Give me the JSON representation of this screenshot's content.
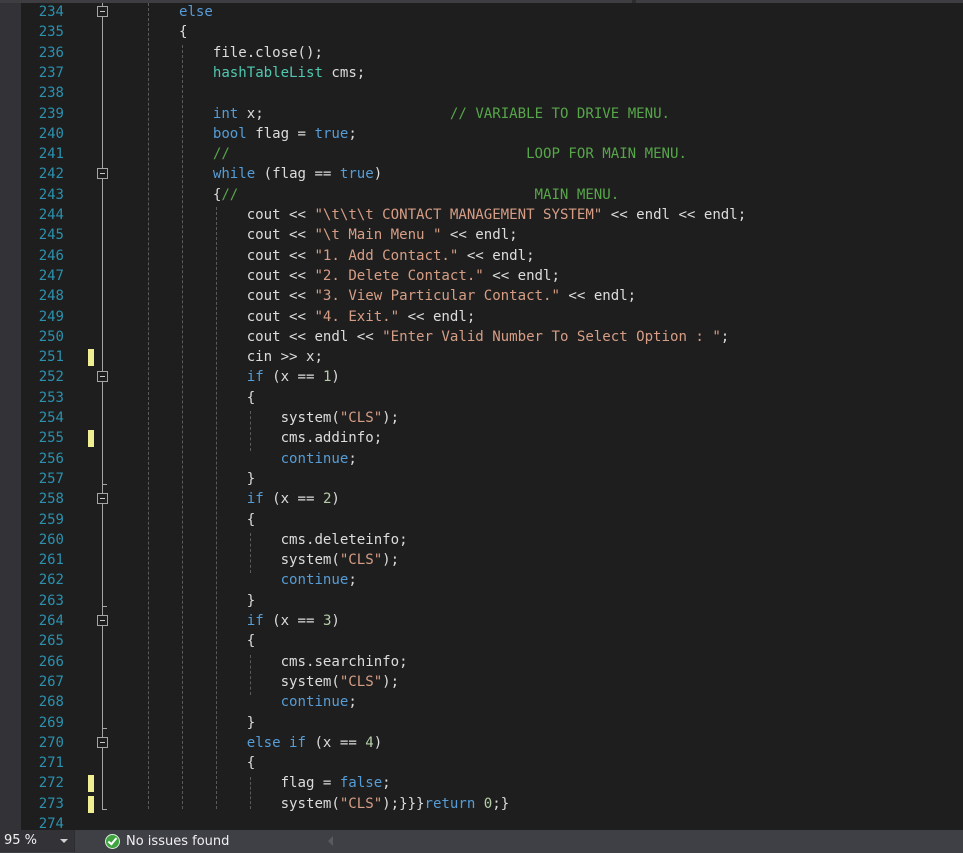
{
  "editor": {
    "lines": [
      {
        "num": "234",
        "tokens": [
          {
            "t": "else",
            "c": "kw"
          }
        ]
      },
      {
        "num": "235",
        "tokens": [
          {
            "t": "{",
            "c": ""
          }
        ]
      },
      {
        "num": "236",
        "tokens": [
          {
            "t": "    file.close();",
            "c": ""
          }
        ]
      },
      {
        "num": "237",
        "tokens": [
          {
            "t": "    ",
            "c": ""
          },
          {
            "t": "hashTableList",
            "c": "ty"
          },
          {
            "t": " cms;",
            "c": ""
          }
        ]
      },
      {
        "num": "238",
        "tokens": []
      },
      {
        "num": "239",
        "tokens": [
          {
            "t": "    ",
            "c": ""
          },
          {
            "t": "int",
            "c": "kw"
          },
          {
            "t": " x;                      ",
            "c": ""
          },
          {
            "t": "// VARIABLE TO DRIVE MENU.",
            "c": "cm"
          }
        ]
      },
      {
        "num": "240",
        "tokens": [
          {
            "t": "    ",
            "c": ""
          },
          {
            "t": "bool",
            "c": "kw"
          },
          {
            "t": " flag = ",
            "c": ""
          },
          {
            "t": "true",
            "c": "kw"
          },
          {
            "t": ";",
            "c": ""
          }
        ]
      },
      {
        "num": "241",
        "tokens": [
          {
            "t": "    ",
            "c": ""
          },
          {
            "t": "//                                   LOOP FOR MAIN MENU.",
            "c": "cm"
          }
        ]
      },
      {
        "num": "242",
        "tokens": [
          {
            "t": "    ",
            "c": ""
          },
          {
            "t": "while",
            "c": "kw"
          },
          {
            "t": " (flag == ",
            "c": ""
          },
          {
            "t": "true",
            "c": "kw"
          },
          {
            "t": ")",
            "c": ""
          }
        ]
      },
      {
        "num": "243",
        "tokens": [
          {
            "t": "    {",
            "c": ""
          },
          {
            "t": "//                                   MAIN MENU.",
            "c": "cm"
          }
        ]
      },
      {
        "num": "244",
        "tokens": [
          {
            "t": "        cout << ",
            "c": ""
          },
          {
            "t": "\"\\t\\t\\t CONTACT MANAGEMENT SYSTEM\"",
            "c": "st"
          },
          {
            "t": " << endl << endl;",
            "c": ""
          }
        ]
      },
      {
        "num": "245",
        "tokens": [
          {
            "t": "        cout << ",
            "c": ""
          },
          {
            "t": "\"\\t Main Menu \"",
            "c": "st"
          },
          {
            "t": " << endl;",
            "c": ""
          }
        ]
      },
      {
        "num": "246",
        "tokens": [
          {
            "t": "        cout << ",
            "c": ""
          },
          {
            "t": "\"1. Add Contact.\"",
            "c": "st"
          },
          {
            "t": " << endl;",
            "c": ""
          }
        ]
      },
      {
        "num": "247",
        "tokens": [
          {
            "t": "        cout << ",
            "c": ""
          },
          {
            "t": "\"2. Delete Contact.\"",
            "c": "st"
          },
          {
            "t": " << endl;",
            "c": ""
          }
        ]
      },
      {
        "num": "248",
        "tokens": [
          {
            "t": "        cout << ",
            "c": ""
          },
          {
            "t": "\"3. View Particular Contact.\"",
            "c": "st"
          },
          {
            "t": " << endl;",
            "c": ""
          }
        ]
      },
      {
        "num": "249",
        "tokens": [
          {
            "t": "        cout << ",
            "c": ""
          },
          {
            "t": "\"4. Exit.\"",
            "c": "st"
          },
          {
            "t": " << endl;",
            "c": ""
          }
        ]
      },
      {
        "num": "250",
        "tokens": [
          {
            "t": "        cout << endl << ",
            "c": ""
          },
          {
            "t": "\"Enter Valid Number To Select Option : \"",
            "c": "st"
          },
          {
            "t": ";",
            "c": ""
          }
        ]
      },
      {
        "num": "251",
        "tokens": [
          {
            "t": "        cin >> x;",
            "c": ""
          }
        ]
      },
      {
        "num": "252",
        "tokens": [
          {
            "t": "        ",
            "c": ""
          },
          {
            "t": "if",
            "c": "kw"
          },
          {
            "t": " (x == ",
            "c": ""
          },
          {
            "t": "1",
            "c": "nu"
          },
          {
            "t": ")",
            "c": ""
          }
        ]
      },
      {
        "num": "253",
        "tokens": [
          {
            "t": "        {",
            "c": ""
          }
        ]
      },
      {
        "num": "254",
        "tokens": [
          {
            "t": "            system(",
            "c": ""
          },
          {
            "t": "\"CLS\"",
            "c": "st"
          },
          {
            "t": ");",
            "c": ""
          }
        ]
      },
      {
        "num": "255",
        "tokens": [
          {
            "t": "            cms.addinfo;",
            "c": ""
          }
        ]
      },
      {
        "num": "256",
        "tokens": [
          {
            "t": "            ",
            "c": ""
          },
          {
            "t": "continue",
            "c": "kw"
          },
          {
            "t": ";",
            "c": ""
          }
        ]
      },
      {
        "num": "257",
        "tokens": [
          {
            "t": "        }",
            "c": ""
          }
        ]
      },
      {
        "num": "258",
        "tokens": [
          {
            "t": "        ",
            "c": ""
          },
          {
            "t": "if",
            "c": "kw"
          },
          {
            "t": " (x == ",
            "c": ""
          },
          {
            "t": "2",
            "c": "nu"
          },
          {
            "t": ")",
            "c": ""
          }
        ]
      },
      {
        "num": "259",
        "tokens": [
          {
            "t": "        {",
            "c": ""
          }
        ]
      },
      {
        "num": "260",
        "tokens": [
          {
            "t": "            cms.deleteinfo;",
            "c": ""
          }
        ]
      },
      {
        "num": "261",
        "tokens": [
          {
            "t": "            system(",
            "c": ""
          },
          {
            "t": "\"CLS\"",
            "c": "st"
          },
          {
            "t": ");",
            "c": ""
          }
        ]
      },
      {
        "num": "262",
        "tokens": [
          {
            "t": "            ",
            "c": ""
          },
          {
            "t": "continue",
            "c": "kw"
          },
          {
            "t": ";",
            "c": ""
          }
        ]
      },
      {
        "num": "263",
        "tokens": [
          {
            "t": "        }",
            "c": ""
          }
        ]
      },
      {
        "num": "264",
        "tokens": [
          {
            "t": "        ",
            "c": ""
          },
          {
            "t": "if",
            "c": "kw"
          },
          {
            "t": " (x == ",
            "c": ""
          },
          {
            "t": "3",
            "c": "nu"
          },
          {
            "t": ")",
            "c": ""
          }
        ]
      },
      {
        "num": "265",
        "tokens": [
          {
            "t": "        {",
            "c": ""
          }
        ]
      },
      {
        "num": "266",
        "tokens": [
          {
            "t": "            cms.searchinfo;",
            "c": ""
          }
        ]
      },
      {
        "num": "267",
        "tokens": [
          {
            "t": "            system(",
            "c": ""
          },
          {
            "t": "\"CLS\"",
            "c": "st"
          },
          {
            "t": ");",
            "c": ""
          }
        ]
      },
      {
        "num": "268",
        "tokens": [
          {
            "t": "            ",
            "c": ""
          },
          {
            "t": "continue",
            "c": "kw"
          },
          {
            "t": ";",
            "c": ""
          }
        ]
      },
      {
        "num": "269",
        "tokens": [
          {
            "t": "        }",
            "c": ""
          }
        ]
      },
      {
        "num": "270",
        "tokens": [
          {
            "t": "        ",
            "c": ""
          },
          {
            "t": "else if",
            "c": "kw"
          },
          {
            "t": " (x == ",
            "c": ""
          },
          {
            "t": "4",
            "c": "nu"
          },
          {
            "t": ")",
            "c": ""
          }
        ]
      },
      {
        "num": "271",
        "tokens": [
          {
            "t": "        {",
            "c": ""
          }
        ]
      },
      {
        "num": "272",
        "tokens": [
          {
            "t": "            flag = ",
            "c": ""
          },
          {
            "t": "false",
            "c": "kw"
          },
          {
            "t": ";",
            "c": ""
          }
        ]
      },
      {
        "num": "273",
        "tokens": [
          {
            "t": "            system(",
            "c": ""
          },
          {
            "t": "\"CLS\"",
            "c": "st"
          },
          {
            "t": ");}}}",
            "c": ""
          },
          {
            "t": "return",
            "c": "kw"
          },
          {
            "t": " ",
            "c": ""
          },
          {
            "t": "0",
            "c": "nu"
          },
          {
            "t": ";}",
            "c": ""
          }
        ]
      },
      {
        "num": "274",
        "tokens": []
      }
    ],
    "changed_lines": [
      "251",
      "255",
      "272",
      "273"
    ],
    "fold_lines": [
      "234",
      "242",
      "252",
      "258",
      "264",
      "270"
    ],
    "colors": {
      "keyword": "#569cd6",
      "type": "#4ec9b0",
      "string": "#d69d85",
      "comment": "#57a64a",
      "number": "#b5cea8",
      "line_number": "#2b91af",
      "change_marker": "#efef91"
    }
  },
  "statusbar": {
    "zoom_level": "95 %",
    "issues_status": "No issues found",
    "issues_icon": "check-circle-icon"
  }
}
